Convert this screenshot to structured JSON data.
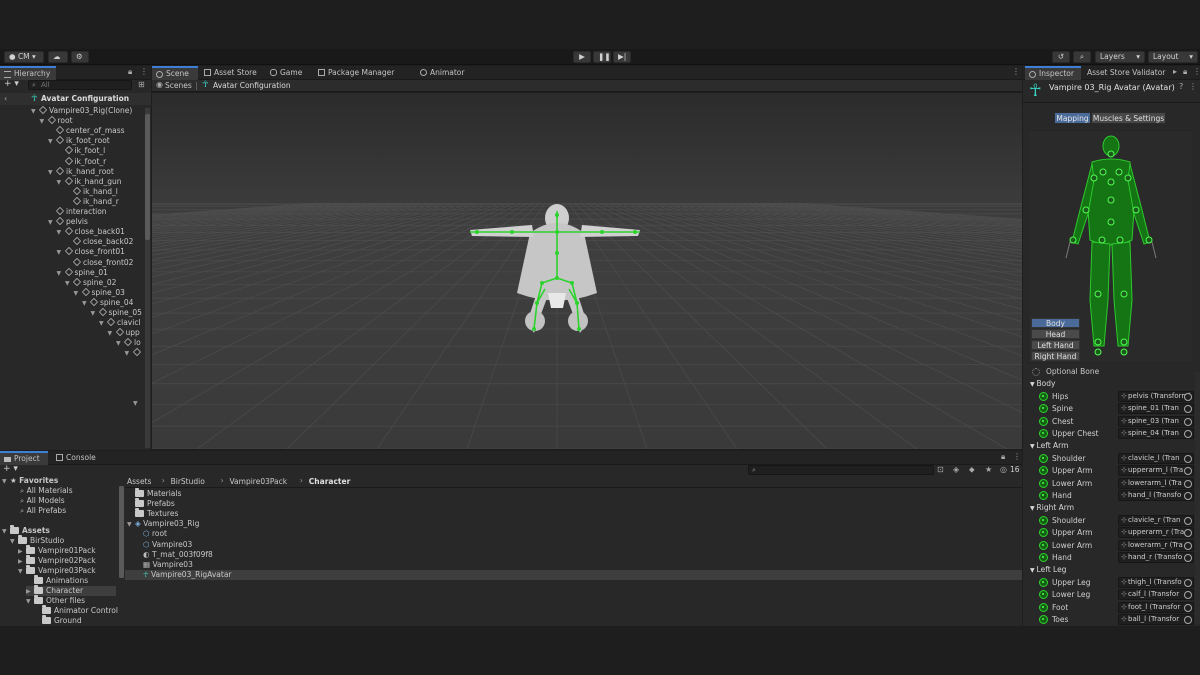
{
  "colors": {
    "accent": "#3c7fd4",
    "bone_green": "#2dd32d",
    "bg": "#282828",
    "scene_bg": "#3a3a3a"
  },
  "toolbar": {
    "account": "CM",
    "layers": "Layers",
    "layout": "Layout",
    "icons": [
      "account-icon",
      "cloud-icon",
      "settings-icon",
      "play-icon",
      "pause-icon",
      "step-icon",
      "history-icon",
      "search-icon"
    ]
  },
  "hierarchy": {
    "tab": "Hierarchy",
    "search_placeholder": "All",
    "header": "Avatar Configuration",
    "items": [
      {
        "label": "Vampire03_Rig(Clone)",
        "depth": 0,
        "arrow": true
      },
      {
        "label": "root",
        "depth": 1,
        "arrow": true
      },
      {
        "label": "center_of_mass",
        "depth": 2,
        "arrow": false
      },
      {
        "label": "ik_foot_root",
        "depth": 2,
        "arrow": true
      },
      {
        "label": "ik_foot_l",
        "depth": 3,
        "arrow": false
      },
      {
        "label": "ik_foot_r",
        "depth": 3,
        "arrow": false
      },
      {
        "label": "ik_hand_root",
        "depth": 2,
        "arrow": true
      },
      {
        "label": "ik_hand_gun",
        "depth": 3,
        "arrow": true
      },
      {
        "label": "ik_hand_l",
        "depth": 4,
        "arrow": false
      },
      {
        "label": "ik_hand_r",
        "depth": 4,
        "arrow": false
      },
      {
        "label": "interaction",
        "depth": 2,
        "arrow": false
      },
      {
        "label": "pelvis",
        "depth": 2,
        "arrow": true
      },
      {
        "label": "close_back01",
        "depth": 3,
        "arrow": true
      },
      {
        "label": "close_back02",
        "depth": 4,
        "arrow": false
      },
      {
        "label": "close_front01",
        "depth": 3,
        "arrow": true
      },
      {
        "label": "close_front02",
        "depth": 4,
        "arrow": false
      },
      {
        "label": "spine_01",
        "depth": 3,
        "arrow": true
      },
      {
        "label": "spine_02",
        "depth": 4,
        "arrow": true
      },
      {
        "label": "spine_03",
        "depth": 5,
        "arrow": true
      },
      {
        "label": "spine_04",
        "depth": 6,
        "arrow": true
      },
      {
        "label": "spine_05",
        "depth": 7,
        "arrow": true
      },
      {
        "label": "clavicl",
        "depth": 8,
        "arrow": true
      },
      {
        "label": "upp",
        "depth": 9,
        "arrow": true
      },
      {
        "label": "lo",
        "depth": 10,
        "arrow": true
      },
      {
        "label": "",
        "depth": 11,
        "arrow": true
      }
    ]
  },
  "center_tabs": [
    "Scene",
    "Asset Store",
    "Game",
    "Package Manager",
    "Animator"
  ],
  "scene": {
    "breadcrumb_root": "Scenes",
    "breadcrumb_current": "Avatar Configuration"
  },
  "inspector": {
    "tabs": [
      "Inspector",
      "Asset Store Validator"
    ],
    "title": "Vampire 03_Rig Avatar (Avatar)",
    "mapping": "Mapping",
    "muscles": "Muscles & Settings",
    "body_parts": [
      "Body",
      "Head",
      "Left Hand",
      "Right Hand"
    ],
    "optional_bone": "Optional Bone",
    "sections": [
      {
        "name": "Body",
        "bones": [
          {
            "label": "Hips",
            "value": "pelvis (Transform)"
          },
          {
            "label": "Spine",
            "value": "spine_01 (Tran"
          },
          {
            "label": "Chest",
            "value": "spine_03 (Tran"
          },
          {
            "label": "Upper Chest",
            "value": "spine_04 (Tran"
          }
        ]
      },
      {
        "name": "Left Arm",
        "bones": [
          {
            "label": "Shoulder",
            "value": "clavicle_l (Tran"
          },
          {
            "label": "Upper Arm",
            "value": "upperarm_l (Tra"
          },
          {
            "label": "Lower Arm",
            "value": "lowerarm_l (Tra"
          },
          {
            "label": "Hand",
            "value": "hand_l (Transfo"
          }
        ]
      },
      {
        "name": "Right Arm",
        "bones": [
          {
            "label": "Shoulder",
            "value": "clavicle_r (Tran"
          },
          {
            "label": "Upper Arm",
            "value": "upperarm_r (Tra"
          },
          {
            "label": "Lower Arm",
            "value": "lowerarm_r (Tra"
          },
          {
            "label": "Hand",
            "value": "hand_r (Transfo"
          }
        ]
      },
      {
        "name": "Left Leg",
        "bones": [
          {
            "label": "Upper Leg",
            "value": "thigh_l (Transfo"
          },
          {
            "label": "Lower Leg",
            "value": "calf_l (Transfor"
          },
          {
            "label": "Foot",
            "value": "foot_l (Transfor"
          },
          {
            "label": "Toes",
            "value": "ball_l (Transfor"
          }
        ]
      }
    ]
  },
  "bottom_tabs": [
    "Project",
    "Console"
  ],
  "project": {
    "search_placeholder": "",
    "hidden_count": "16",
    "favorites_label": "Favorites",
    "favorites": [
      "All Materials",
      "All Models",
      "All Prefabs"
    ],
    "assets_label": "Assets",
    "tree": [
      {
        "label": "BirStudio",
        "depth": 1
      },
      {
        "label": "Vampire01Pack",
        "depth": 2
      },
      {
        "label": "Vampire02Pack",
        "depth": 2
      },
      {
        "label": "Vampire03Pack",
        "depth": 2
      },
      {
        "label": "Animations",
        "depth": 3
      },
      {
        "label": "Character",
        "depth": 3
      },
      {
        "label": "Other files",
        "depth": 3
      },
      {
        "label": "Animator Control",
        "depth": 4
      },
      {
        "label": "Ground",
        "depth": 4
      }
    ],
    "breadcrumb": [
      "Assets",
      "BirStudio",
      "Vampire03Pack",
      "Character"
    ],
    "files": [
      {
        "label": "Materials",
        "icon": "folder-icon",
        "depth": 0
      },
      {
        "label": "Prefabs",
        "icon": "folder-icon",
        "depth": 0
      },
      {
        "label": "Textures",
        "icon": "folder-icon",
        "depth": 0
      },
      {
        "label": "Vampire03_Rig",
        "icon": "model-icon",
        "depth": 0
      },
      {
        "label": "root",
        "icon": "gameobject-icon",
        "depth": 1
      },
      {
        "label": "Vampire03",
        "icon": "gameobject-icon",
        "depth": 1
      },
      {
        "label": "T_mat_003f09f8",
        "icon": "material-icon",
        "depth": 1
      },
      {
        "label": "Vampire03",
        "icon": "mesh-icon",
        "depth": 1
      },
      {
        "label": "Vampire03_RigAvatar",
        "icon": "avatar-icon",
        "depth": 1
      }
    ]
  }
}
